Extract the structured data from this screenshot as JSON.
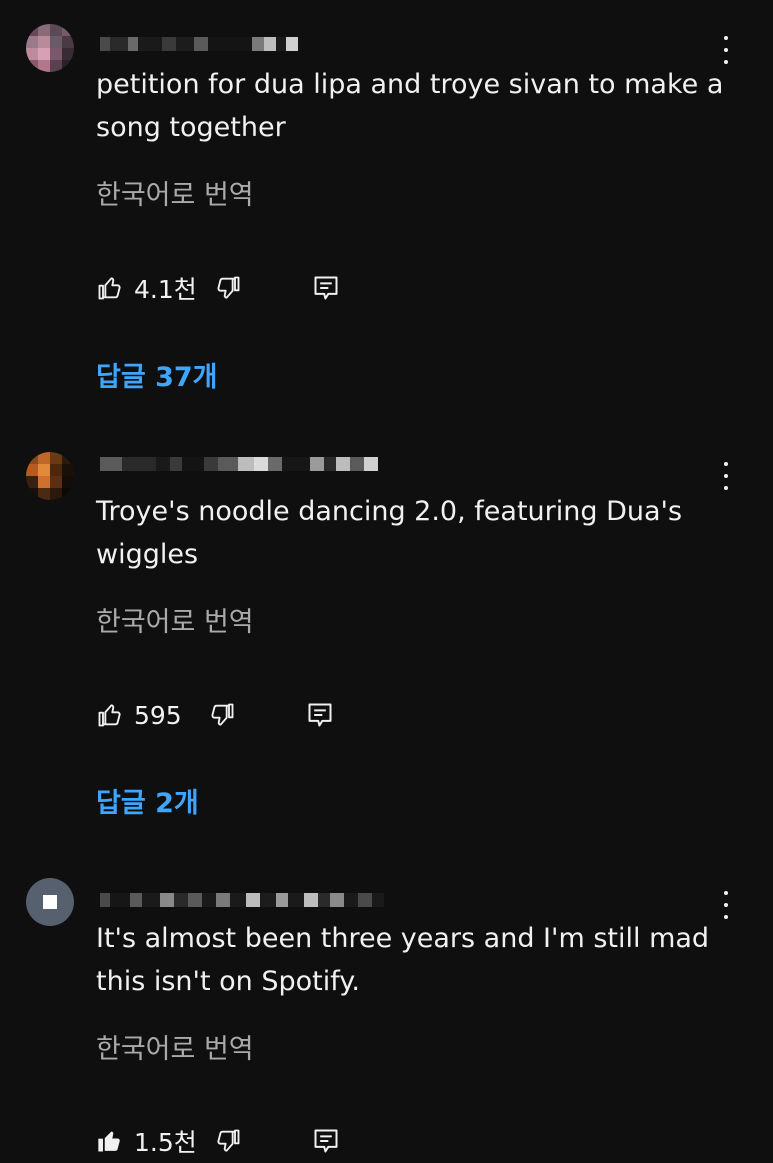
{
  "comments": [
    {
      "text": "petition for dua lipa and troye sivan to make a song together",
      "translate": "한국어로 번역",
      "likes": "4.1천",
      "liked": false,
      "replies": "답글 37개"
    },
    {
      "text": "Troye's noodle dancing 2.0, featuring Dua's wiggles",
      "translate": "한국어로 번역",
      "likes": "595",
      "liked": false,
      "replies": "답글 2개"
    },
    {
      "text": "It's almost been three years and I'm still mad this isn't on Spotify.",
      "translate": "한국어로 번역",
      "likes": "1.5천",
      "liked": true
    }
  ],
  "icons": {
    "like": "thumb-up-icon",
    "dislike": "thumb-down-icon",
    "reply": "reply-icon",
    "more": "more-vert-icon"
  },
  "colors": {
    "background": "#0f0f0f",
    "text": "#f1f1f1",
    "secondary": "#aaaaaa",
    "link": "#3ea6ff"
  }
}
